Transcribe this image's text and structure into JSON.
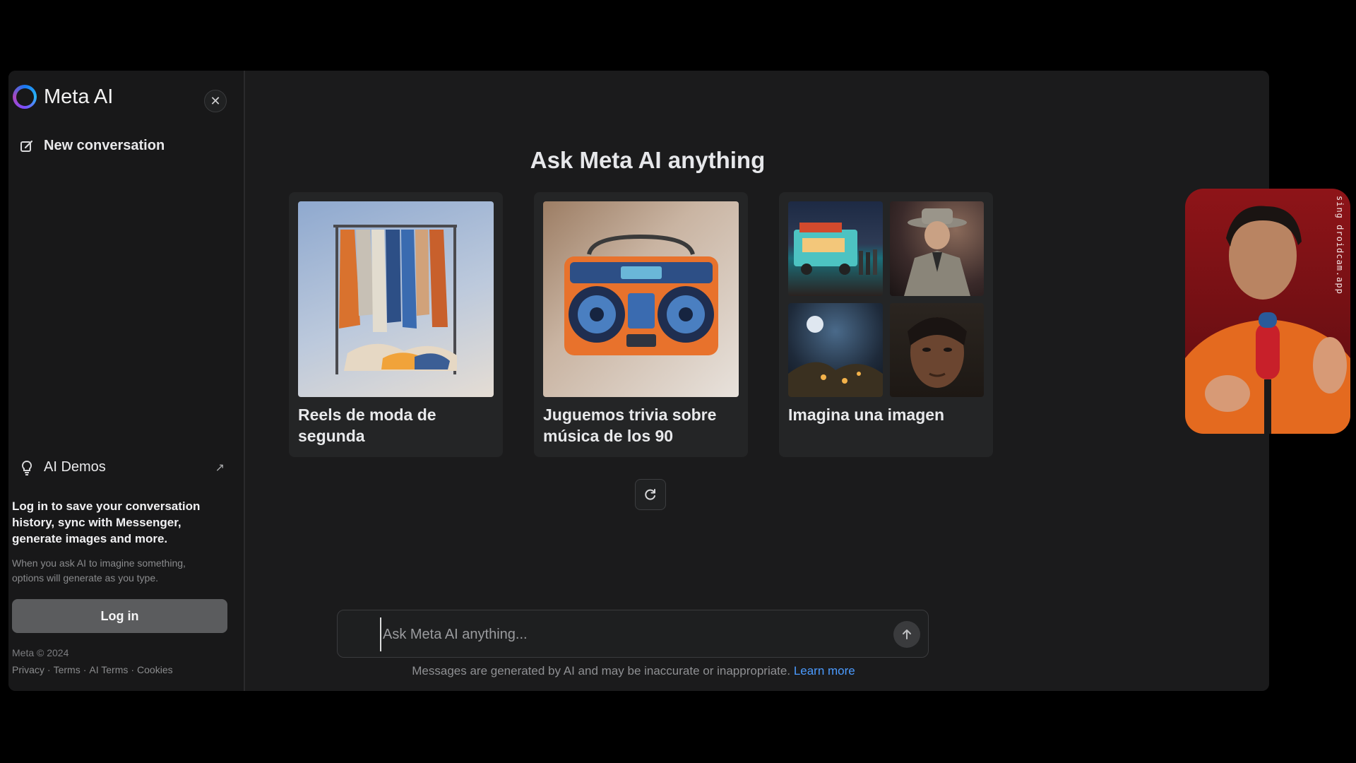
{
  "sidebar": {
    "brand": "Meta AI",
    "new_conversation": "New conversation",
    "ai_demos": "AI Demos",
    "login_message": "Log in to save your conversation history, sync with Messenger, generate images and more.",
    "login_subtext": "When you ask AI to imagine something, options will generate as you type.",
    "login_button": "Log in",
    "copyright": "Meta © 2024",
    "footer_links": [
      "Privacy",
      "Terms",
      "AI Terms",
      "Cookies"
    ]
  },
  "main": {
    "headline": "Ask Meta AI anything",
    "cards": [
      {
        "label": "Reels de moda de segunda"
      },
      {
        "label": "Juguemos trivia sobre música de los 90"
      },
      {
        "label": "Imagina una imagen"
      }
    ],
    "input": {
      "placeholder": "Ask Meta AI anything..."
    },
    "disclaimer": "Messages are generated by AI and may be inaccurate or inappropriate.",
    "learn_more": "Learn more"
  },
  "webcam": {
    "overlay_text": "sing droidcam.app"
  },
  "colors": {
    "accent_link": "#4b9bff",
    "background": "#1b1b1c",
    "sidebar": "#181819"
  },
  "icons": [
    "close-icon",
    "edit-icon",
    "lightbulb-icon",
    "external-arrow-icon",
    "refresh-icon",
    "send-arrow-icon"
  ]
}
